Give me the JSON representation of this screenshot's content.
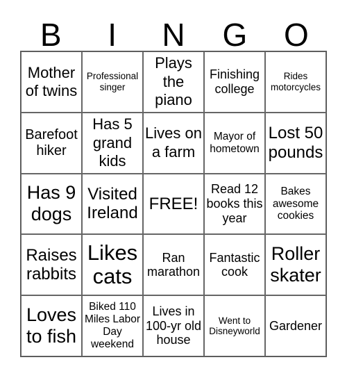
{
  "header": {
    "letters": [
      "B",
      "I",
      "N",
      "G",
      "O"
    ]
  },
  "grid": {
    "cells": [
      "Mother of twins",
      "Professional singer",
      "Plays the piano",
      "Finishing college",
      "Rides motorcycles",
      "Barefoot hiker",
      "Has 5 grand kids",
      "Lives on a farm",
      "Mayor of hometown",
      "Lost 50 pounds",
      "Has 9 dogs",
      "Visited Ireland",
      "FREE!",
      "Read 12 books this year",
      "Bakes awesome cookies",
      "Raises rabbits",
      "Likes cats",
      "Ran marathon",
      "Fantastic cook",
      "Roller skater",
      "Loves to fish",
      "Biked 110 Miles Labor Day weekend",
      "Lives in 100-yr old house",
      "Went to Disneyworld",
      "Gardener"
    ]
  }
}
